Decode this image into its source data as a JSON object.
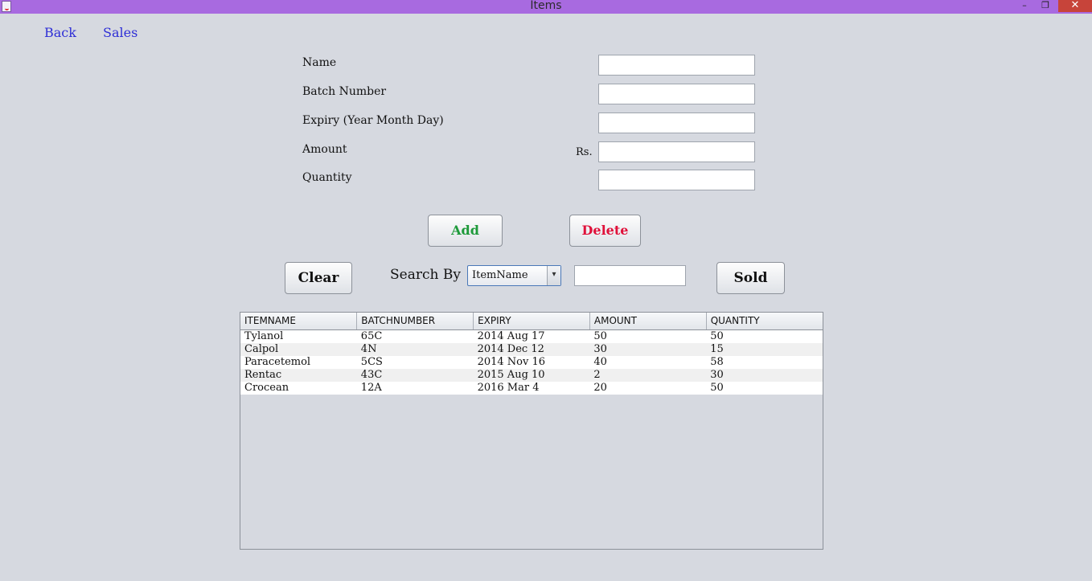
{
  "window": {
    "title": "Items",
    "minimize": "–",
    "maximize": "❐",
    "close": "✕"
  },
  "nav": {
    "back": "Back",
    "sales": "Sales"
  },
  "form": {
    "name_label": "Name",
    "batch_label": "Batch Number",
    "expiry_label": "Expiry (Year Month Day)",
    "amount_label": "Amount",
    "currency_prefix": "Rs.",
    "quantity_label": "Quantity",
    "name_value": "",
    "batch_value": "",
    "expiry_value": "",
    "amount_value": "",
    "quantity_value": ""
  },
  "buttons": {
    "add": "Add",
    "delete": "Delete",
    "clear": "Clear",
    "sold": "Sold"
  },
  "search": {
    "label": "Search By",
    "selected": "ItemName",
    "arrow": "▾",
    "value": ""
  },
  "table": {
    "columns": [
      "ITEMNAME",
      "BATCHNUMBER",
      "EXPIRY",
      "AMOUNT",
      "QUANTITY"
    ],
    "rows": [
      [
        "Tylanol",
        "65C",
        "2014 Aug 17",
        "50",
        "50"
      ],
      [
        "Calpol",
        "4N",
        "2014 Dec 12",
        "30",
        "15"
      ],
      [
        "Paracetemol",
        "5CS",
        "2014 Nov 16",
        "40",
        "58"
      ],
      [
        "Rentac",
        "43C",
        "2015 Aug 10",
        "2",
        "30"
      ],
      [
        "Crocean",
        "12A",
        "2016 Mar 4",
        "20",
        "50"
      ]
    ]
  },
  "colors": {
    "titlebar": "#a86ae0",
    "link": "#2e2ed6",
    "add": "#1e9a3a",
    "delete": "#e0113a",
    "close": "#c7443a"
  },
  "icons": {
    "app": "java-cup-icon",
    "combo": "dropdown-arrow-icon"
  }
}
